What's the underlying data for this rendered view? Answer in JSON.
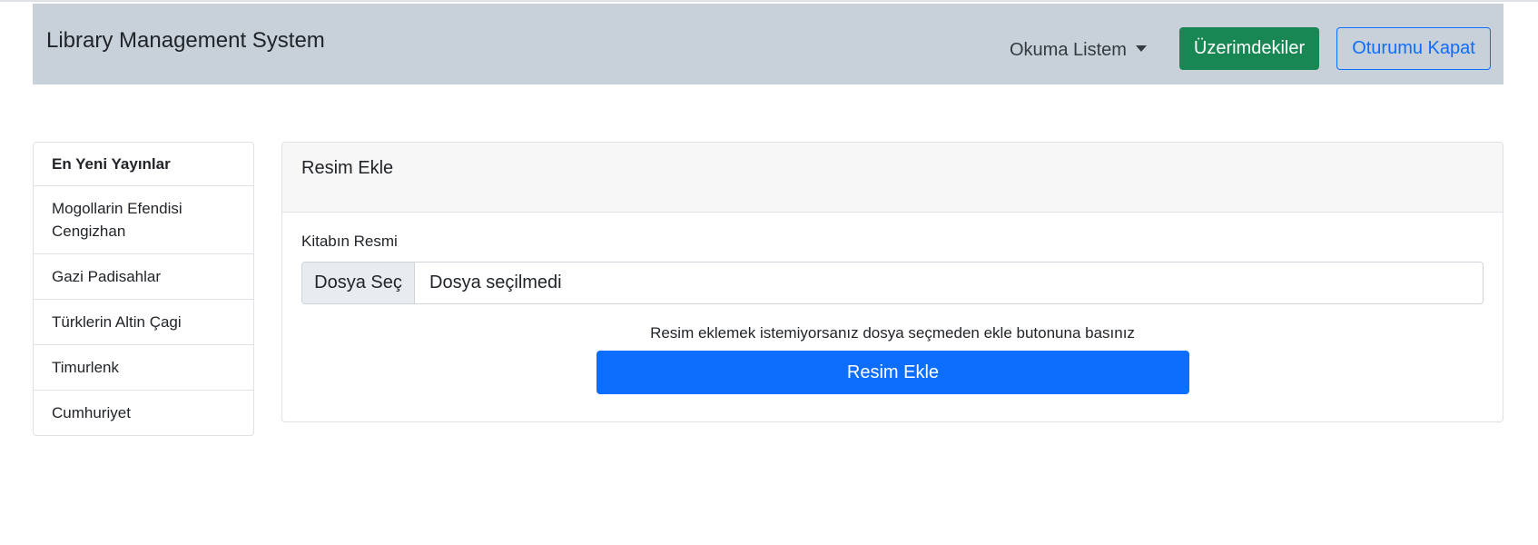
{
  "navbar": {
    "brand": "Library Management System",
    "reading_list_label": "Okuma Listem",
    "my_books_label": "Üzerimdekiler",
    "logout_label": "Oturumu Kapat"
  },
  "sidebar": {
    "heading": "En Yeni Yayınlar",
    "items": [
      {
        "label": "Mogollarin Efendisi Cengizhan"
      },
      {
        "label": "Gazi Padisahlar"
      },
      {
        "label": "Türklerin Altin Çagi"
      },
      {
        "label": "Timurlenk"
      },
      {
        "label": "Cumhuriyet"
      }
    ]
  },
  "card": {
    "header": "Resim Ekle",
    "field_label": "Kitabın Resmi",
    "file_button_label": "Dosya Seç",
    "file_status": "Dosya seçilmedi",
    "help_text": "Resim eklemek istemiyorsanız dosya seçmeden ekle butonuna basınız",
    "submit_label": "Resim Ekle"
  },
  "colors": {
    "navbar_bg": "#c8d0da",
    "success": "#198754",
    "primary": "#0d6efd"
  },
  "icons": {
    "dropdown": "caret-down-icon"
  }
}
